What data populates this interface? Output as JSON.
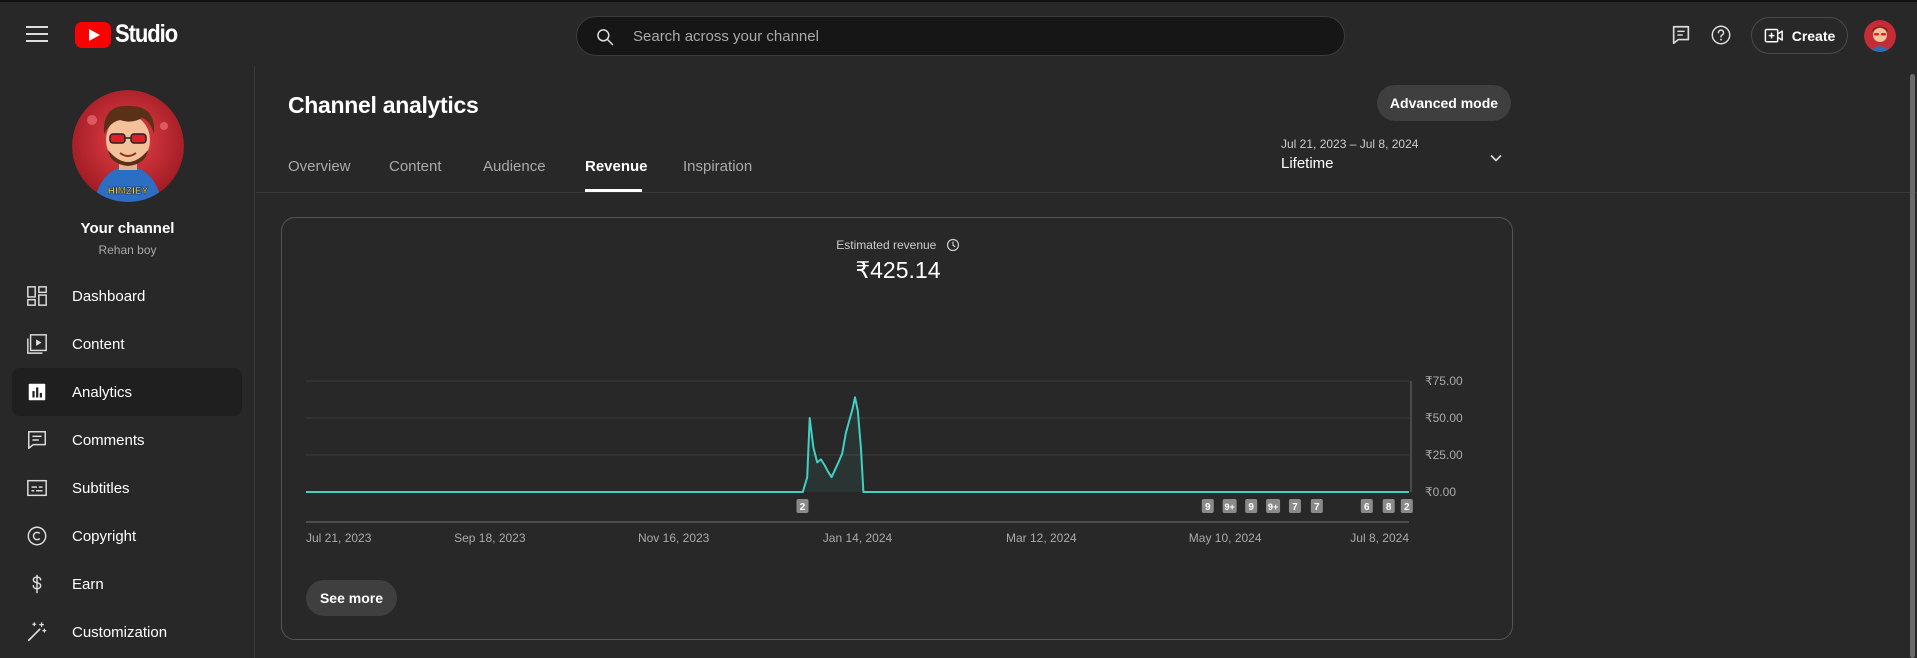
{
  "app": {
    "logo_text": "Studio"
  },
  "search": {
    "placeholder": "Search across your channel"
  },
  "header": {
    "create_label": "Create"
  },
  "sidebar": {
    "channel_title": "Your channel",
    "channel_name": "Rehan boy",
    "avatar_badge_text": "HIMZIEY",
    "items": [
      {
        "label": "Dashboard",
        "icon": "dashboard-icon"
      },
      {
        "label": "Content",
        "icon": "content-icon"
      },
      {
        "label": "Analytics",
        "icon": "analytics-icon",
        "active": true
      },
      {
        "label": "Comments",
        "icon": "comments-icon"
      },
      {
        "label": "Subtitles",
        "icon": "subtitles-icon"
      },
      {
        "label": "Copyright",
        "icon": "copyright-icon"
      },
      {
        "label": "Earn",
        "icon": "dollar-icon"
      },
      {
        "label": "Customization",
        "icon": "magic-wand-icon"
      }
    ]
  },
  "main": {
    "title": "Channel analytics",
    "advanced_mode_label": "Advanced mode",
    "tabs": [
      {
        "label": "Overview"
      },
      {
        "label": "Content"
      },
      {
        "label": "Audience"
      },
      {
        "label": "Revenue",
        "active": true
      },
      {
        "label": "Inspiration"
      }
    ],
    "date_range": "Jul 21, 2023 – Jul 8, 2024",
    "date_preset": "Lifetime"
  },
  "card": {
    "metric_label": "Estimated revenue",
    "metric_value": "₹425.14",
    "see_more_label": "See more"
  },
  "colors": {
    "line": "#3fd1c2",
    "accent": "#ff0000"
  },
  "chart_data": {
    "type": "line",
    "x_ticks": [
      "Jul 21, 2023",
      "Sep 18, 2023",
      "Nov 16, 2023",
      "Jan 14, 2024",
      "Mar 12, 2024",
      "May 10, 2024",
      "Jul 8, 2024"
    ],
    "y_ticks": [
      "₹75.00",
      "₹50.00",
      "₹25.00",
      "₹0.00"
    ],
    "ylim": [
      0,
      75
    ],
    "x_domain_days": [
      0,
      353
    ],
    "grid": true,
    "series": [
      {
        "points": [
          [
            0,
            0
          ],
          [
            159,
            0
          ],
          [
            160.4,
            10
          ],
          [
            161.2,
            50
          ],
          [
            162.4,
            30
          ],
          [
            163.6,
            20
          ],
          [
            164.8,
            22
          ],
          [
            166,
            18
          ],
          [
            167,
            14
          ],
          [
            168.2,
            10
          ],
          [
            169.3,
            15
          ],
          [
            170.4,
            20
          ],
          [
            171.6,
            26
          ],
          [
            172.8,
            40
          ],
          [
            174.1,
            50
          ],
          [
            174.9,
            56
          ],
          [
            175.7,
            64
          ],
          [
            176.6,
            55
          ],
          [
            177.6,
            30
          ],
          [
            178.4,
            0
          ],
          [
            353,
            0
          ]
        ]
      }
    ],
    "markers": [
      {
        "day": 158.9,
        "label": "2"
      },
      {
        "day": 288.6,
        "label": "9"
      },
      {
        "day": 295.6,
        "label": "9+"
      },
      {
        "day": 302.5,
        "label": "9"
      },
      {
        "day": 309.5,
        "label": "9+"
      },
      {
        "day": 316.5,
        "label": "7"
      },
      {
        "day": 323.5,
        "label": "7"
      },
      {
        "day": 339.5,
        "label": "6"
      },
      {
        "day": 346.5,
        "label": "8"
      },
      {
        "day": 352.3,
        "label": "2"
      }
    ]
  }
}
